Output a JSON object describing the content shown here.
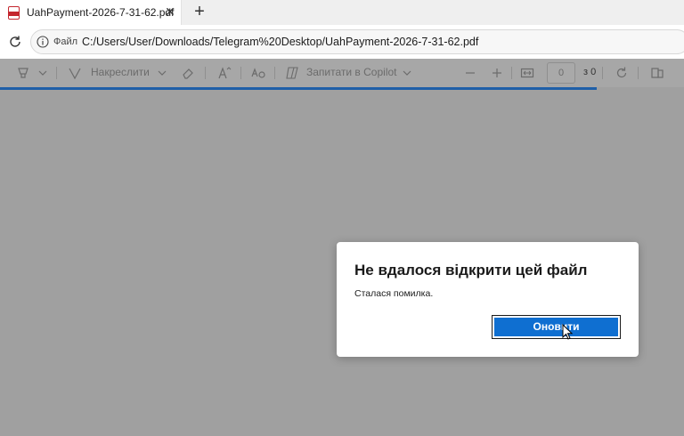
{
  "tab": {
    "title": "UahPayment-2026-7-31-62.pdf",
    "close": "✕",
    "new_tab": "+"
  },
  "address": {
    "file_label": "Файл",
    "url": "C:/Users/User/Downloads/Telegram%20Desktop/UahPayment-2026-7-31-62.pdf"
  },
  "toolbar": {
    "draw_label": "Накреслити",
    "copilot_label": "Запитати в Copilot",
    "page_value": "0",
    "page_total": "з 0"
  },
  "dialog": {
    "title": "Не вдалося відкрити цей файл",
    "message": "Сталася помилка.",
    "button_label": "Оновити"
  },
  "colors": {
    "accent": "#0f6fd1",
    "progress": "#1f5fa8",
    "overlay": "#a0a0a0"
  }
}
